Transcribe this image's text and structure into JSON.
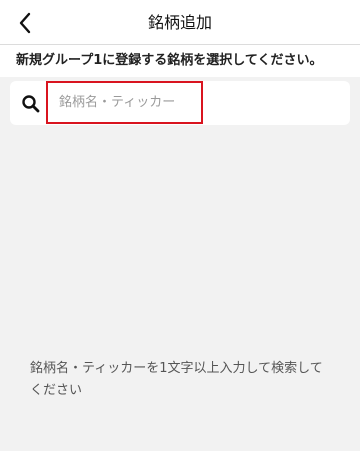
{
  "header": {
    "title": "銘柄追加",
    "back_icon": "chevron-left-icon"
  },
  "instruction": "新規グループ1に登録する銘柄を選択してください。",
  "search": {
    "placeholder": "銘柄名・ティッカー",
    "value": "",
    "icon": "search-icon"
  },
  "hint": "銘柄名・ティッカーを1文字以上入力して検索してください",
  "colors": {
    "background": "#f2f2f2",
    "highlight_border": "#d9141f"
  }
}
